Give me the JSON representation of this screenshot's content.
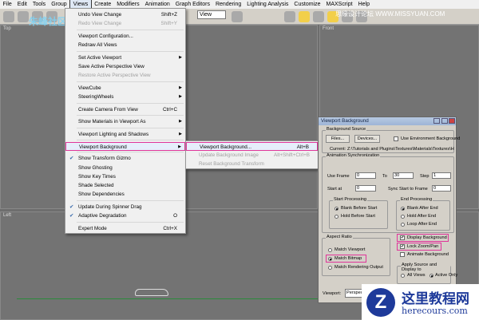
{
  "menubar": [
    "File",
    "Edit",
    "Tools",
    "Group",
    "Views",
    "Create",
    "Modifiers",
    "Animation",
    "Graph Editors",
    "Rendering",
    "Lighting Analysis",
    "Customize",
    "MAXScript",
    "Help"
  ],
  "toolbar": {
    "view_select": "View"
  },
  "viewports": {
    "top": "Top",
    "front": "Front",
    "left": "Left"
  },
  "views_menu": [
    {
      "label": "Undo View Change",
      "shortcut": "Shift+Z"
    },
    {
      "label": "Redo View Change",
      "shortcut": "Shift+Y",
      "disabled": true
    },
    {
      "label": "Viewport Configuration..."
    },
    {
      "label": "Redraw All Views"
    },
    {
      "label": "Set Active Viewport",
      "arrow": "▶"
    },
    {
      "label": "Save Active Perspective View"
    },
    {
      "label": "Restore Active Perspective View",
      "disabled": true
    },
    {
      "label": "ViewCube",
      "arrow": "▶"
    },
    {
      "label": "SteeringWheels",
      "arrow": "▶"
    },
    {
      "label": "Create Camera From View",
      "shortcut": "Ctrl+C"
    },
    {
      "label": "Show Materials in Viewport As",
      "arrow": "▶"
    },
    {
      "label": "Viewport Lighting and Shadows",
      "arrow": "▶"
    },
    {
      "label": "Viewport Background",
      "arrow": "▶",
      "highlight": true
    },
    {
      "label": "Show Transform Gizmo",
      "check": "✔"
    },
    {
      "label": "Show Ghosting"
    },
    {
      "label": "Show Key Times"
    },
    {
      "label": "Shade Selected"
    },
    {
      "label": "Show Dependencies"
    },
    {
      "label": "Update During Spinner Drag",
      "check": "✔"
    },
    {
      "label": "Adaptive Degradation",
      "check": "✔",
      "shortcut": "O"
    },
    {
      "label": "Expert Mode",
      "shortcut": "Ctrl+X"
    }
  ],
  "submenu": [
    {
      "label": "Viewport Background...",
      "shortcut": "Alt+B"
    },
    {
      "label": "Update Background Image",
      "shortcut": "Alt+Shift+Ctrl+B",
      "disabled": true
    },
    {
      "label": "Reset Background Transform",
      "disabled": true
    }
  ],
  "dialog": {
    "title": "Viewport Background",
    "bg_source": "Background Source",
    "files": "Files...",
    "devices": "Devices...",
    "use_env": "Use Environment Background",
    "current_label": "Current:",
    "current_path": "Z:\\Tutorials and Plugins\\Textures\\Materials\\Textures\\Hdri",
    "anim_sync": "Animation Synchronization",
    "use_frame": "Use Frame",
    "use_frame_val": "0",
    "to": "To",
    "to_val": "30",
    "step": "Step",
    "step_val": "1",
    "start_at": "Start at",
    "start_at_val": "0",
    "sync_start": "Sync Start to Frame",
    "sync_start_val": "0",
    "start_proc": "Start Processing",
    "blank_before": "Blank Before Start",
    "hold_before": "Hold Before Start",
    "end_proc": "End Processing",
    "blank_after": "Blank After End",
    "hold_after": "Hold After End",
    "loop_after": "Loop After End",
    "aspect": "Aspect Ratio",
    "match_vp": "Match Viewport",
    "match_bmp": "Match Bitmap",
    "match_render": "Match Rendering Output",
    "display_bg": "Display Background",
    "lock_zoom": "Lock Zoom/Pan",
    "animate_bg": "Animate Background",
    "apply": "Apply Source and Display to",
    "all_views": "All Views",
    "active_only": "Active Only",
    "viewport_label": "Viewport:",
    "viewport_val": "Perspective"
  },
  "watermarks": {
    "top_left": "朱峰社区 ZF3D",
    "top_right": "思缘设计论坛 WWW.MISSYUAN.COM",
    "logo": "Z",
    "cn": "这里教程网",
    "en": "herecours.com"
  }
}
